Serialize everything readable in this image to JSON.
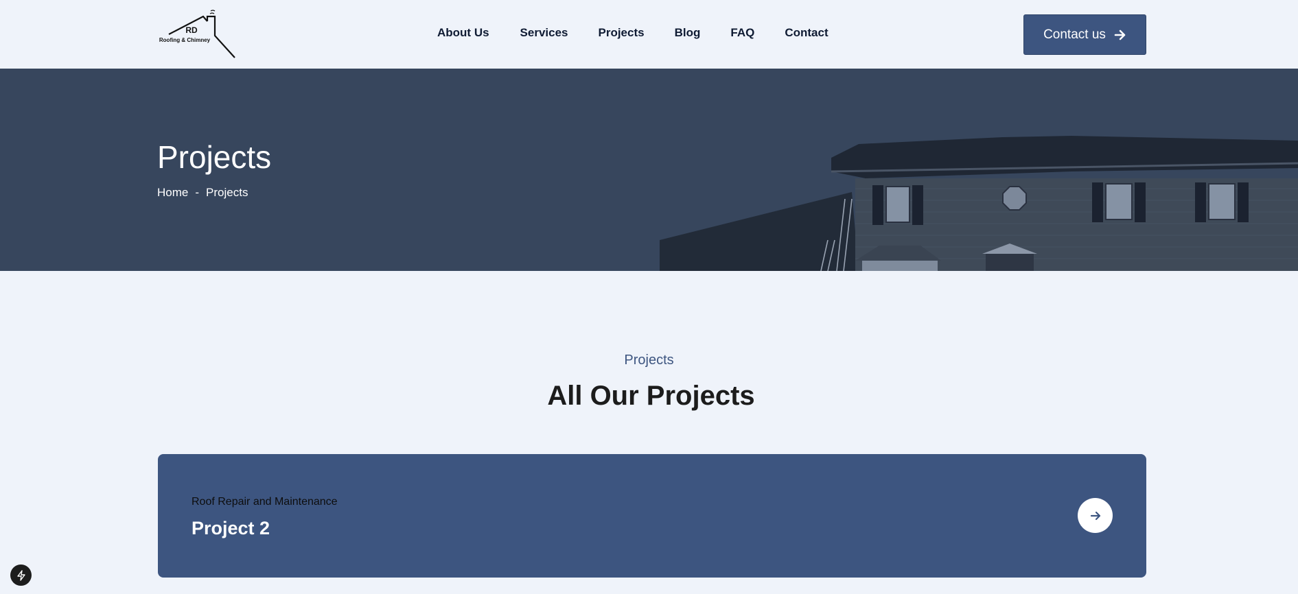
{
  "brand": {
    "logo_initials": "RD",
    "logo_subtitle": "Roofing & Chimney"
  },
  "nav": {
    "items": [
      {
        "label": "About Us"
      },
      {
        "label": "Services"
      },
      {
        "label": "Projects"
      },
      {
        "label": "Blog"
      },
      {
        "label": "FAQ"
      },
      {
        "label": "Contact"
      }
    ]
  },
  "header_cta": {
    "label": "Contact us",
    "icon": "arrow-right-icon"
  },
  "hero": {
    "title": "Projects",
    "breadcrumb": {
      "home": "Home",
      "separator": "-",
      "current": "Projects"
    }
  },
  "section": {
    "eyebrow": "Projects",
    "title": "All Our Projects"
  },
  "projects": [
    {
      "category": "Roof Repair and Maintenance",
      "title": "Project 2",
      "icon": "arrow-right-icon"
    }
  ],
  "colors": {
    "primary": "#3d5580",
    "hero_overlay": "#37465d",
    "page_bg": "#eff3fa",
    "nav_text": "#0f1b33"
  },
  "widgets": {
    "fab_icon": "lightning-icon"
  }
}
